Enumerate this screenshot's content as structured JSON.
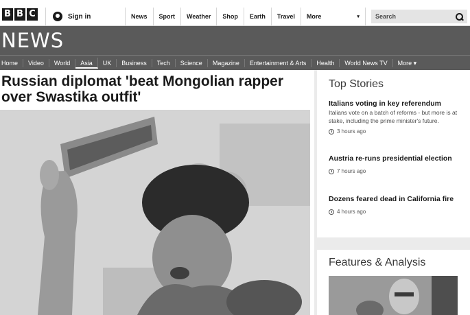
{
  "brand": {
    "logo_letters": [
      "B",
      "B",
      "C"
    ],
    "news_title": "NEWS"
  },
  "topbar": {
    "signin_label": "Sign in",
    "nav": [
      "News",
      "Sport",
      "Weather",
      "Shop",
      "Earth",
      "Travel"
    ],
    "more_label": "More",
    "search_placeholder": "Search"
  },
  "section_nav": {
    "items": [
      "Home",
      "Video",
      "World",
      "Asia",
      "UK",
      "Business",
      "Tech",
      "Science",
      "Magazine",
      "Entertainment & Arts",
      "Health",
      "World News TV",
      "More ▾"
    ],
    "active": "Asia"
  },
  "article": {
    "headline": "Russian diplomat 'beat Mongolian rapper over Swastika outfit'"
  },
  "top_stories": {
    "title": "Top Stories",
    "stories": [
      {
        "headline": "Italians voting in key referendum",
        "summary": "Italians vote on a batch of reforms - but more is at stake, including the prime minister's future.",
        "time": "3 hours ago"
      },
      {
        "headline": "Austria re-runs presidential election",
        "summary": "",
        "time": "7 hours ago"
      },
      {
        "headline": "Dozens feared dead in California fire",
        "summary": "",
        "time": "4 hours ago"
      }
    ]
  },
  "features": {
    "title": "Features & Analysis"
  },
  "colors": {
    "newsbar": "#5a5a5a",
    "page_bg": "#ebebeb",
    "text": "#1a1a1a"
  }
}
